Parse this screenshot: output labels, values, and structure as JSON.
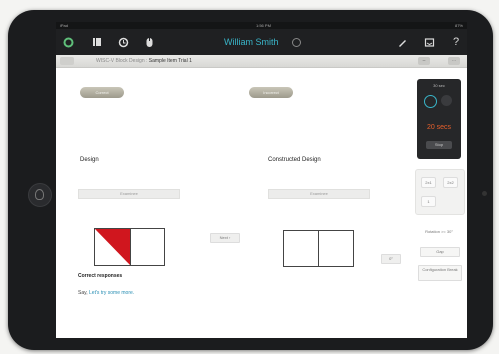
{
  "status_bar": {
    "left": "iPad",
    "time": "1:56 PM",
    "right": "87%"
  },
  "nav": {
    "user_name": "William Smith",
    "icons": [
      "app-logo-icon",
      "grid-icon",
      "clock-icon",
      "mouse-icon",
      "pencil-icon",
      "inbox-icon",
      "help-icon"
    ],
    "help_label": "?"
  },
  "breadcrumb": {
    "path_prefix": "WISC-V Block Design :",
    "path_current": "Sample Item Trial 1",
    "right_buttons": [
      "–",
      "⋯"
    ]
  },
  "left_panel": {
    "top_button": "Correct",
    "heading": "Design",
    "examiner_label": "Examinee",
    "response_title": "Correct responses",
    "response_text": "Say,",
    "response_link": "Let's try some more."
  },
  "middle": {
    "button": "Next ›"
  },
  "right_panel": {
    "top_button": "Incorrect",
    "heading": "Constructed Design",
    "examiner_label": "Examinee",
    "rotation_value": "0°"
  },
  "timer": {
    "label": "30 sec",
    "time": "20 secs",
    "stop_label": "Stop"
  },
  "grid_controls": [
    "2x1",
    "2x2",
    "1"
  ],
  "side": {
    "rotation_label": "Rotation >= 30°",
    "gap_button": "Gap",
    "config_button": "Configuration Break"
  },
  "colors": {
    "accent": "#39b5c9",
    "timer_orange": "#e8602c",
    "block_red": "#d0161e"
  }
}
